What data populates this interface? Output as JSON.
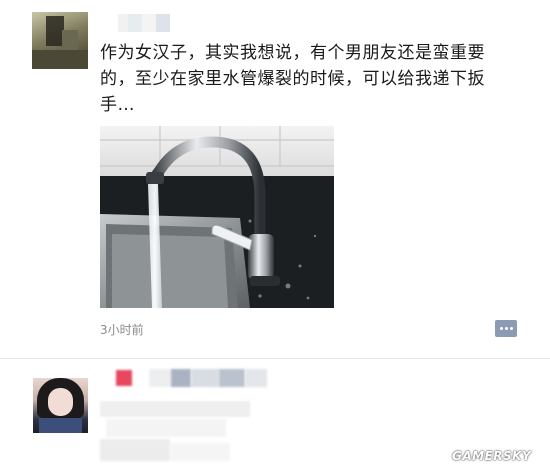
{
  "post": {
    "text": "作为女汉子，其实我想说，有个男朋友还是蛮重要的，至少在家里水管爆裂的时候，可以给我递下扳手…",
    "time": "3小时前",
    "comment_icon": "comment-dots-icon"
  },
  "watermark": "GAMERSKY",
  "colors": {
    "text": "#1a1a1a",
    "timestamp": "#8a8a8a",
    "comment_button": "#8b9bb4",
    "divider": "#e6e6e6"
  }
}
